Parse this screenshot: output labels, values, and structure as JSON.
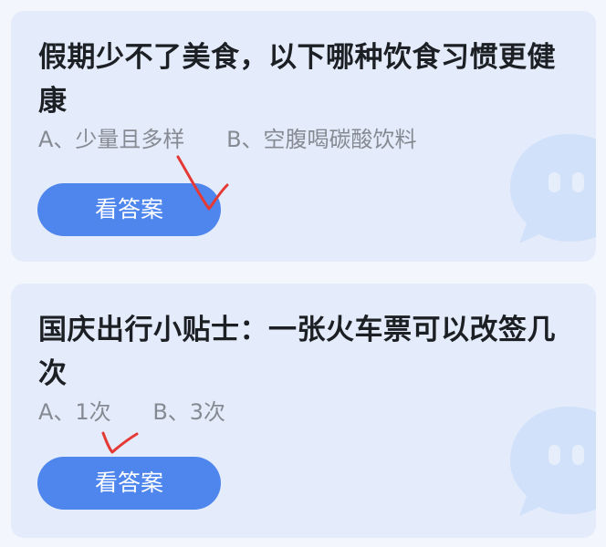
{
  "colors": {
    "page_background": "#f3f6fc",
    "card_background": "#e4ecfb",
    "button": "#4e86ee",
    "mark": "#e53935"
  },
  "quizzes": [
    {
      "question": "假期少不了美食，以下哪种饮食习惯更健康",
      "options": [
        "A、少量且多样",
        "B、空腹喝碳酸饮料"
      ],
      "button_label": "看答案"
    },
    {
      "question": "国庆出行小贴士：一张火车票可以改签几次",
      "options": [
        "A、1次",
        "B、3次"
      ],
      "button_label": "看答案"
    }
  ],
  "icons": [
    "chat-bubble-icon",
    "checkmark-icon"
  ]
}
